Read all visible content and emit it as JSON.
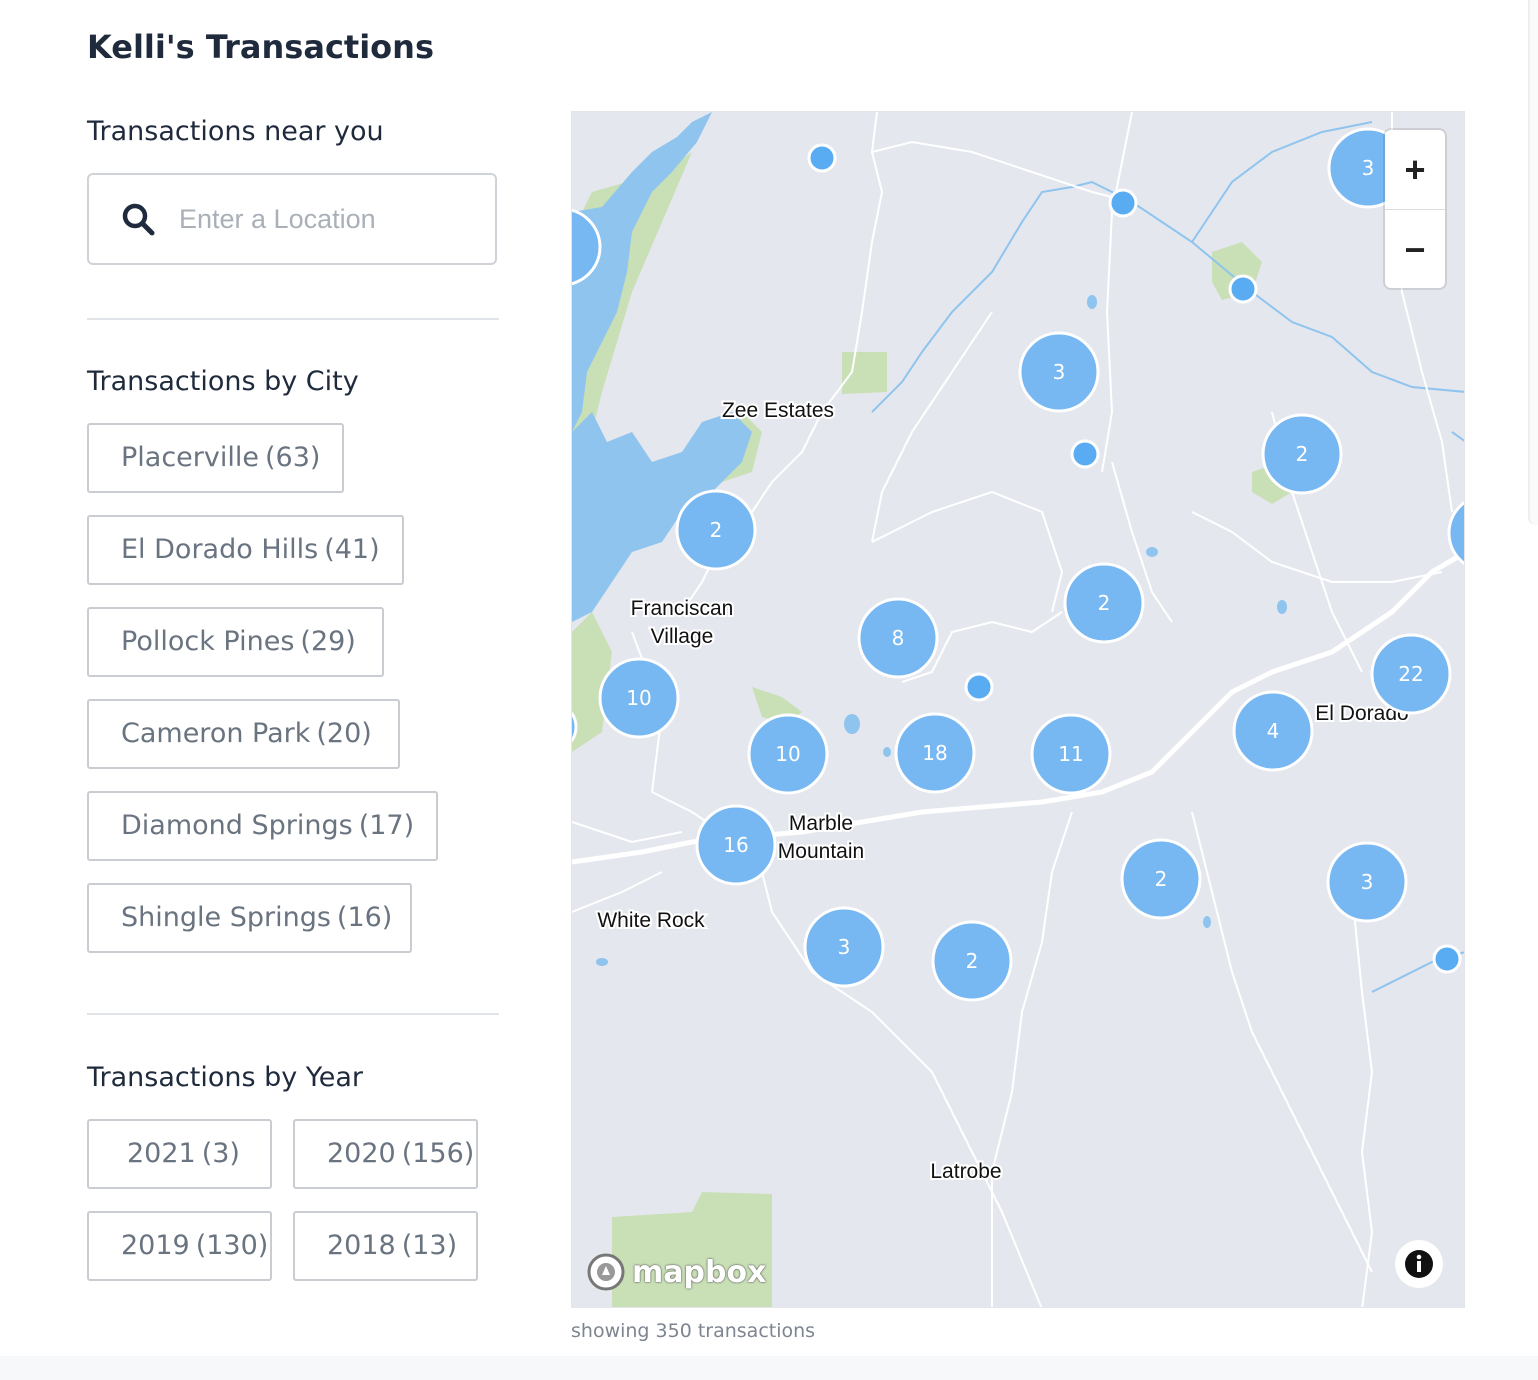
{
  "page": {
    "title": "Kelli's Transactions"
  },
  "near": {
    "title": "Transactions near you",
    "search_placeholder": "Enter a Location",
    "search_value": ""
  },
  "by_city": {
    "title": "Transactions by City",
    "items": [
      {
        "label": "Placerville",
        "count": "(63)"
      },
      {
        "label": "El Dorado Hills",
        "count": "(41)"
      },
      {
        "label": "Pollock Pines",
        "count": "(29)"
      },
      {
        "label": "Cameron Park",
        "count": "(20)"
      },
      {
        "label": "Diamond Springs",
        "count": "(17)"
      },
      {
        "label": "Shingle Springs",
        "count": "(16)"
      }
    ]
  },
  "by_year": {
    "title": "Transactions by Year",
    "items": [
      {
        "label": "2021",
        "count": "(3)"
      },
      {
        "label": "2020",
        "count": "(156)"
      },
      {
        "label": "2019",
        "count": "(130)"
      },
      {
        "label": "2018",
        "count": "(13)"
      }
    ]
  },
  "map": {
    "place_labels": [
      "Zee Estates",
      "Franciscan",
      "Village",
      "Marble",
      "Mountain",
      "White Rock",
      "Latrobe",
      "El Dorado"
    ],
    "cluster_counts": [
      "3",
      "3",
      "2",
      "2",
      "2",
      "8",
      "10",
      "10",
      "18",
      "11",
      "4",
      "22",
      "16",
      "2",
      "3",
      "3",
      "2"
    ],
    "zoom_in": "+",
    "zoom_out": "−",
    "attribution": "mapbox",
    "colors": {
      "cluster": "#78b8f2",
      "marker": "#5aacf2",
      "water": "#8ec4ee",
      "park": "#c9dfb6",
      "land": "#e5e7ee"
    }
  },
  "footer": {
    "summary": "showing 350 transactions"
  }
}
